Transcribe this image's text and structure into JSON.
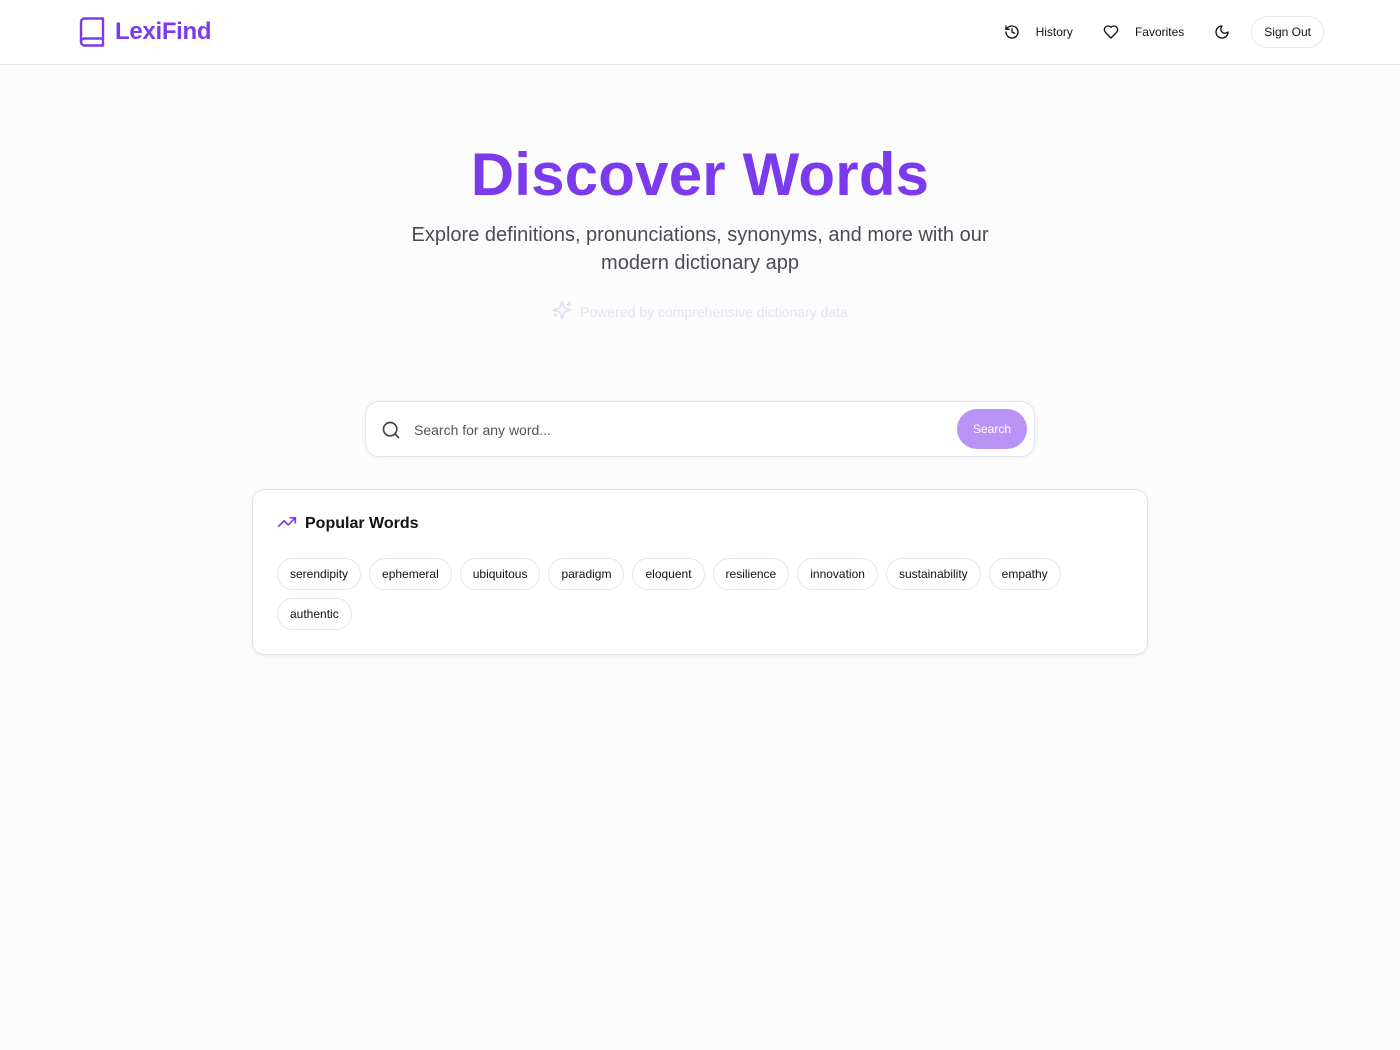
{
  "app": {
    "name": "LexiFind",
    "brand_color": "#7c3aed",
    "logo_icon": "book-icon"
  },
  "nav": {
    "history_label": "History",
    "favorites_label": "Favorites",
    "theme_icon": "moon-icon",
    "signout_label": "Sign Out"
  },
  "hero": {
    "title": "Discover Words",
    "subtitle": "Explore definitions, pronunciations, synonyms, and more with our modern dictionary app",
    "powered": "Powered by comprehensive dictionary data"
  },
  "search": {
    "placeholder": "Search for any word...",
    "button_label": "Search",
    "button_color": "#b993f5"
  },
  "popular": {
    "title": "Popular Words",
    "icon": "trending-up-icon",
    "words": [
      "serendipity",
      "ephemeral",
      "ubiquitous",
      "paradigm",
      "eloquent",
      "resilience",
      "innovation",
      "sustainability",
      "empathy",
      "authentic"
    ]
  }
}
